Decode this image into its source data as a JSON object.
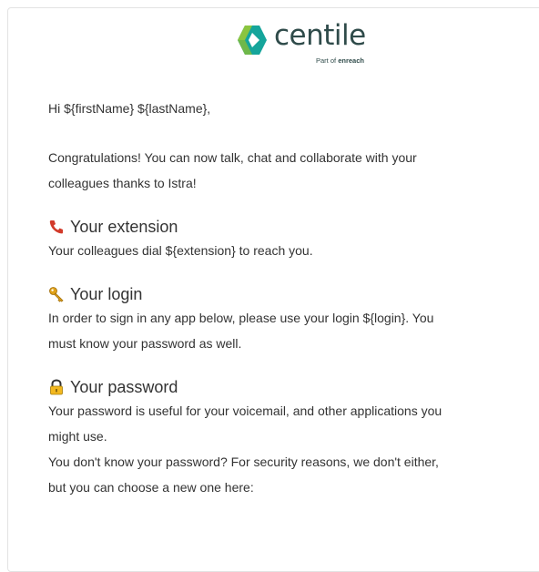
{
  "logo": {
    "wordmark": "centile",
    "tagline_prefix": "Part of ",
    "tagline_brand": "enreach",
    "colors": {
      "green": "#8bc53f",
      "teal": "#15a59b",
      "dark": "#2f4b4a"
    }
  },
  "email": {
    "greeting": "Hi ${firstName} ${lastName},",
    "intro_line1": "Congratulations! You can now talk, chat and collaborate with your",
    "intro_line2": "colleagues thanks to Istra!",
    "sections": [
      {
        "icon": "phone-icon",
        "title": "Your extension",
        "lines": [
          "Your colleagues dial ${extension} to reach you."
        ]
      },
      {
        "icon": "key-icon",
        "title": "Your login",
        "lines": [
          "In order to sign in any app below, please use your login ${login}. You",
          "must know your password as well."
        ]
      },
      {
        "icon": "lock-icon",
        "title": "Your password",
        "lines": [
          "Your password is useful for your voicemail, and other applications you",
          "might use.",
          "You don't know your password? For security reasons, we don't either,",
          "but you can choose a new one here:"
        ]
      }
    ]
  }
}
